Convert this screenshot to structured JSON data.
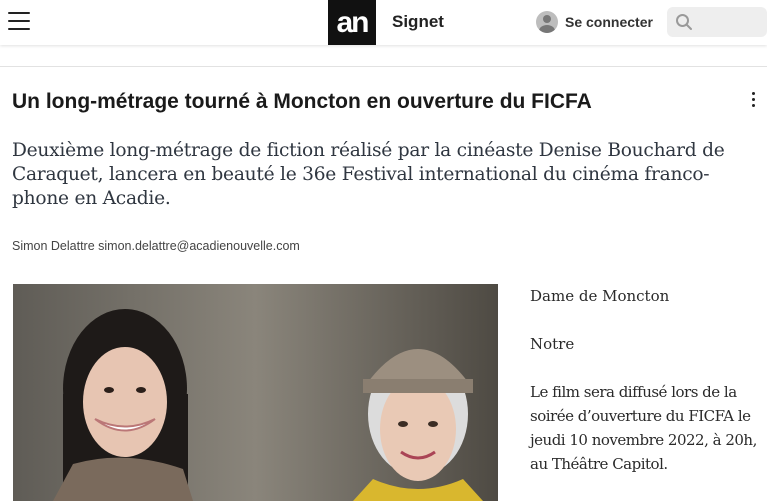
{
  "header": {
    "logo_text": "an",
    "section_label": "Signet",
    "login_label": "Se connecter",
    "search_placeholder": ""
  },
  "article": {
    "title": "Un long-métrage tourné à Moncton en ouverture du FICFA",
    "subtitle": "Deuxième long-métrage de fiction réalisé par la cinéaste Denise Bouchard de Caraquet, lancera en beauté le 36e Festival international du cinéma franco-phone en Acadie.",
    "byline": "Simon Delattre simon.delattre@acadienouvelle.com",
    "side_paragraphs": [
      "Dame de Moncton",
      "Notre",
      "Le film sera diffusé lors de la soirée d’ouverture du FICFA le jeudi 10 novembre 2022, à 20h, au Théâtre Capitol."
    ]
  },
  "icons": {
    "menu": "hamburger-menu-icon",
    "user": "user-avatar-icon",
    "search": "search-icon",
    "more": "more-vertical-icon"
  },
  "colors": {
    "logo_bg": "#111111",
    "search_bg": "#eeeeee",
    "subtitle_text": "#2f3640"
  }
}
